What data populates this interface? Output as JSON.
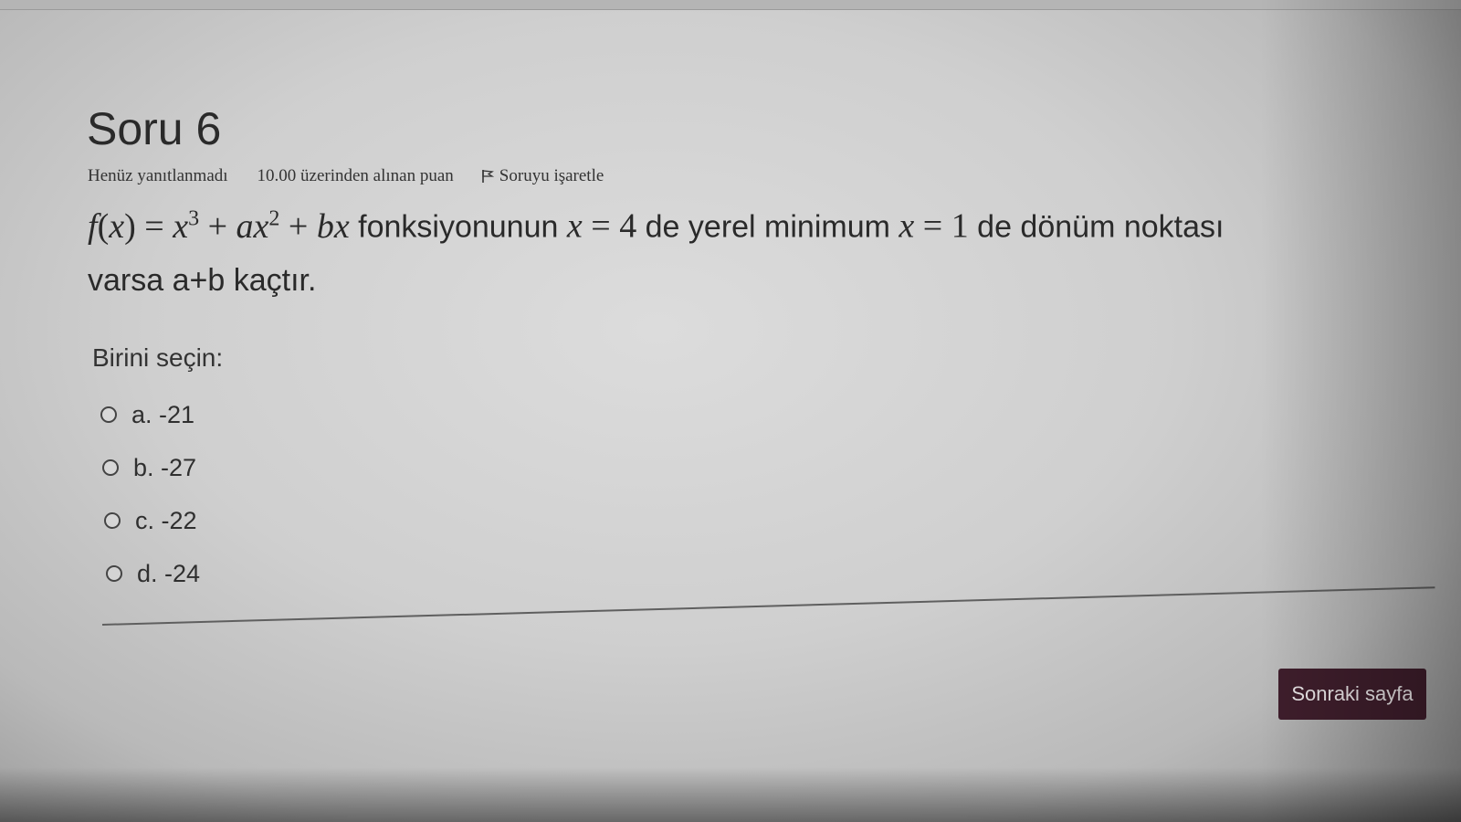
{
  "question": {
    "title": "Soru 6",
    "status": "Henüz yanıtlanmadı",
    "grade": "10.00 üzerinden alınan puan",
    "flag_label": "Soruyu işaretle",
    "text_after_formula": "fonksiyonunun",
    "text_local_min": "de yerel minimum",
    "text_inflection": "de dönüm noktası",
    "text_line2": "varsa a+b kaçtır.",
    "prompt": "Birini seçin:"
  },
  "formula": {
    "f": "f",
    "x": "x",
    "a": "a",
    "b": "b",
    "power3": "3",
    "power2": "2",
    "val4": "4",
    "val1": "1"
  },
  "options": [
    {
      "letter": "a.",
      "value": "-21"
    },
    {
      "letter": "b.",
      "value": "-27"
    },
    {
      "letter": "c.",
      "value": "-22"
    },
    {
      "letter": "d.",
      "value": "-24"
    }
  ],
  "navigation": {
    "next_label": "Sonraki sayfa"
  },
  "colors": {
    "button_bg": "#3f1e2c",
    "text": "#2a2a2a"
  },
  "icons": {
    "flag": "flag-icon",
    "radio": "radio-icon"
  }
}
